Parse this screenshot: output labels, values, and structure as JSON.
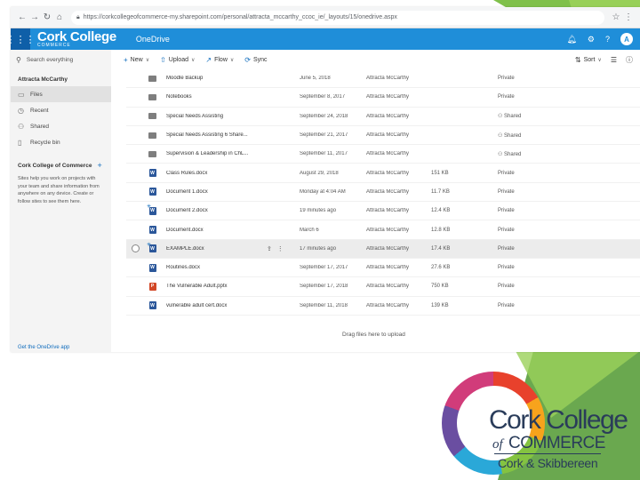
{
  "browser": {
    "url": "https://corkcollegeofcommerce-my.sharepoint.com/personal/attracta_mccarthy_ccoc_ie/_layouts/15/onedrive.aspx"
  },
  "suite": {
    "brand_main": "Cork College",
    "brand_sub": "COMMERCE",
    "app_name": "OneDrive",
    "avatar_letter": "A",
    "header_color": "#1f8ed9"
  },
  "nav": {
    "search_placeholder": "Search everything",
    "user_name": "Attracta McCarthy",
    "items": [
      {
        "label": "Files",
        "icon": "folder-icon"
      },
      {
        "label": "Recent",
        "icon": "clock-icon"
      },
      {
        "label": "Shared",
        "icon": "people-icon"
      },
      {
        "label": "Recycle bin",
        "icon": "trash-icon"
      }
    ],
    "section_title": "Cork College of Commerce",
    "section_desc": "Sites help you work on projects with your team and share information from anywhere on any device. Create or follow sites to see them here.",
    "footer_link": "Get the OneDrive app"
  },
  "commands": {
    "new": "New",
    "upload": "Upload",
    "flow": "Flow",
    "sync": "Sync",
    "sort": "Sort"
  },
  "files": [
    {
      "name": "Moodle Backup",
      "type": "folder",
      "modified": "June 5, 2018",
      "by": "Attracta McCarthy",
      "size": "",
      "sharing": "Private"
    },
    {
      "name": "Notebooks",
      "type": "folder",
      "modified": "September 8, 2017",
      "by": "Attracta McCarthy",
      "size": "",
      "sharing": "Private"
    },
    {
      "name": "Special Needs Assisting",
      "type": "folder",
      "modified": "September 24, 2018",
      "by": "Attracta McCarthy",
      "size": "",
      "sharing": "Shared"
    },
    {
      "name": "Special Needs Assisting 6 Share...",
      "type": "folder",
      "modified": "September 21, 2017",
      "by": "Attracta McCarthy",
      "size": "",
      "sharing": "Shared"
    },
    {
      "name": "Supervision & Leadership in ChL...",
      "type": "folder",
      "modified": "September 11, 2017",
      "by": "Attracta McCarthy",
      "size": "",
      "sharing": "Shared"
    },
    {
      "name": "Class Rules.docx",
      "type": "docx",
      "modified": "August 29, 2018",
      "by": "Attracta McCarthy",
      "size": "151 KB",
      "sharing": "Private"
    },
    {
      "name": "Document 1.docx",
      "type": "docx",
      "modified": "Monday at 4:04 AM",
      "by": "Attracta McCarthy",
      "size": "11.7 KB",
      "sharing": "Private"
    },
    {
      "name": "Document 2.docx",
      "type": "docx",
      "new": true,
      "modified": "19 minutes ago",
      "by": "Attracta McCarthy",
      "size": "12.4 KB",
      "sharing": "Private"
    },
    {
      "name": "Document.docx",
      "type": "docx",
      "modified": "March 6",
      "by": "Attracta McCarthy",
      "size": "12.8 KB",
      "sharing": "Private"
    },
    {
      "name": "EXAMPLE.docx",
      "type": "docx",
      "new": true,
      "highlighted": true,
      "modified": "17 minutes ago",
      "by": "Attracta McCarthy",
      "size": "17.4 KB",
      "sharing": "Private"
    },
    {
      "name": "Routines.docx",
      "type": "docx",
      "modified": "September 17, 2017",
      "by": "Attracta McCarthy",
      "size": "27.6 KB",
      "sharing": "Private"
    },
    {
      "name": "The Vulnerable Adult.pptx",
      "type": "pptx",
      "modified": "September 17, 2018",
      "by": "Attracta McCarthy",
      "size": "750 KB",
      "sharing": "Private"
    },
    {
      "name": "vulnerable adult cert.docx",
      "type": "docx",
      "modified": "September 11, 2018",
      "by": "Attracta McCarthy",
      "size": "139 KB",
      "sharing": "Private"
    }
  ],
  "drop_text": "Drag files here to upload",
  "logo": {
    "line1": "Cork College",
    "of": "of",
    "commerce": "COMMERCE",
    "line3": "Cork & Skibbereen",
    "text_color": "#2a3c5a"
  },
  "decor": {
    "green_dark": "#6aa84f",
    "green_light": "#9bd15a"
  }
}
